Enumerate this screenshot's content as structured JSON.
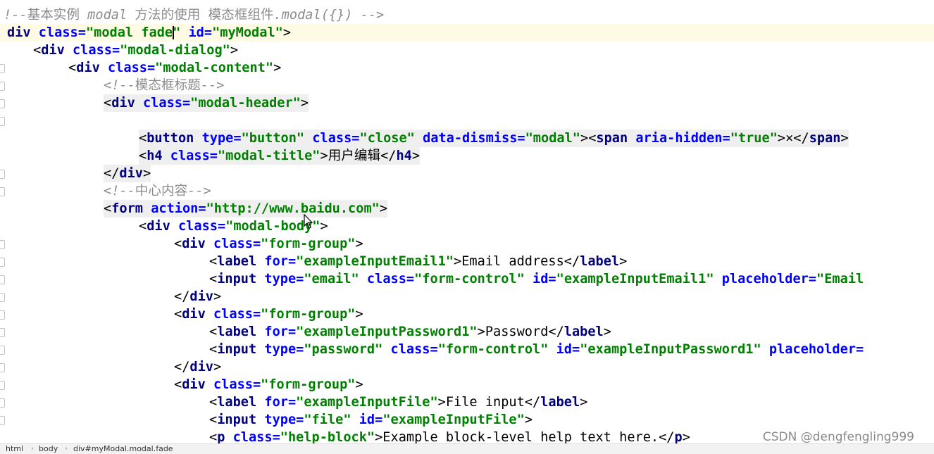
{
  "editor": {
    "lines": [
      {
        "segs": [
          [
            "c",
            "!--基本实例 modal 方法的使用 模态框组件.modal({}) -->"
          ]
        ]
      },
      {
        "current": true,
        "segs": [
          [
            "t",
            "div "
          ],
          [
            "a",
            "class="
          ],
          [
            "v",
            "\"modal fade\""
          ],
          [
            "a",
            " id="
          ],
          [
            "v",
            "\"myModal\""
          ],
          [
            "x",
            ">"
          ]
        ]
      },
      {
        "segs": [
          [
            "x",
            "<"
          ],
          [
            "t",
            "div "
          ],
          [
            "a",
            "class="
          ],
          [
            "v",
            "\"modal-dialog\""
          ],
          [
            "x",
            ">"
          ]
        ]
      },
      {
        "segs": [
          [
            "x",
            "<"
          ],
          [
            "t",
            "div "
          ],
          [
            "a",
            "class="
          ],
          [
            "v",
            "\"modal-content\""
          ],
          [
            "x",
            ">"
          ]
        ]
      },
      {
        "segs": [
          [
            "c",
            "<!--模态框标题-->"
          ]
        ]
      },
      {
        "hl": true,
        "segs": [
          [
            "x",
            "<"
          ],
          [
            "t",
            "div "
          ],
          [
            "a",
            "class="
          ],
          [
            "v",
            "\"modal-header\""
          ],
          [
            "x",
            ">"
          ]
        ]
      },
      {
        "segs": []
      },
      {
        "hl": true,
        "segs": [
          [
            "x",
            "<"
          ],
          [
            "t",
            "button "
          ],
          [
            "a",
            "type="
          ],
          [
            "v",
            "\"button\""
          ],
          [
            "a",
            " class="
          ],
          [
            "v",
            "\"close\""
          ],
          [
            "a",
            " data-dismiss="
          ],
          [
            "v",
            "\"modal\""
          ],
          [
            "x",
            ">"
          ],
          [
            "x",
            "<"
          ],
          [
            "t",
            "span "
          ],
          [
            "a",
            "aria-hidden="
          ],
          [
            "v",
            "\"true\""
          ],
          [
            "x",
            ">"
          ],
          [
            "x",
            "×</"
          ],
          [
            "t",
            "span"
          ],
          [
            "x",
            ">"
          ]
        ]
      },
      {
        "hl": true,
        "segs": [
          [
            "x",
            "<"
          ],
          [
            "t",
            "h4 "
          ],
          [
            "a",
            "class="
          ],
          [
            "v",
            "\"modal-title\""
          ],
          [
            "x",
            ">"
          ],
          [
            "x",
            "用户编辑"
          ],
          [
            "x",
            "</"
          ],
          [
            "t",
            "h4"
          ],
          [
            "x",
            ">"
          ]
        ]
      },
      {
        "hl": true,
        "segs": [
          [
            "x",
            "</"
          ],
          [
            "t",
            "div"
          ],
          [
            "x",
            ">"
          ]
        ]
      },
      {
        "segs": [
          [
            "c",
            "<!--中心内容-->"
          ]
        ]
      },
      {
        "hl": true,
        "segs": [
          [
            "x",
            "<"
          ],
          [
            "t",
            "form "
          ],
          [
            "a",
            "action="
          ],
          [
            "v",
            "\"http://www.baidu.com\""
          ],
          [
            "x",
            ">"
          ]
        ]
      },
      {
        "segs": [
          [
            "x",
            "<"
          ],
          [
            "t",
            "div "
          ],
          [
            "a",
            "class="
          ],
          [
            "v",
            "\"modal-body\""
          ],
          [
            "x",
            ">"
          ]
        ]
      },
      {
        "segs": [
          [
            "x",
            "<"
          ],
          [
            "t",
            "div "
          ],
          [
            "a",
            "class="
          ],
          [
            "v",
            "\"form-group\""
          ],
          [
            "x",
            ">"
          ]
        ]
      },
      {
        "segs": [
          [
            "x",
            "<"
          ],
          [
            "t",
            "label "
          ],
          [
            "a",
            "for="
          ],
          [
            "v",
            "\"exampleInputEmail1\""
          ],
          [
            "x",
            ">Email address</"
          ],
          [
            "t",
            "label"
          ],
          [
            "x",
            ">"
          ]
        ]
      },
      {
        "segs": [
          [
            "x",
            "<"
          ],
          [
            "t",
            "input "
          ],
          [
            "a",
            "type="
          ],
          [
            "v",
            "\"email\""
          ],
          [
            "a",
            " class="
          ],
          [
            "v",
            "\"form-control\""
          ],
          [
            "a",
            " id="
          ],
          [
            "v",
            "\"exampleInputEmail1\""
          ],
          [
            "a",
            " placeholder="
          ],
          [
            "v",
            "\"Email"
          ]
        ]
      },
      {
        "segs": [
          [
            "x",
            "</"
          ],
          [
            "t",
            "div"
          ],
          [
            "x",
            ">"
          ]
        ]
      },
      {
        "segs": [
          [
            "x",
            "<"
          ],
          [
            "t",
            "div "
          ],
          [
            "a",
            "class="
          ],
          [
            "v",
            "\"form-group\""
          ],
          [
            "x",
            ">"
          ]
        ]
      },
      {
        "segs": [
          [
            "x",
            "<"
          ],
          [
            "t",
            "label "
          ],
          [
            "a",
            "for="
          ],
          [
            "v",
            "\"exampleInputPassword1\""
          ],
          [
            "x",
            ">Password</"
          ],
          [
            "t",
            "label"
          ],
          [
            "x",
            ">"
          ]
        ]
      },
      {
        "segs": [
          [
            "x",
            "<"
          ],
          [
            "t",
            "input "
          ],
          [
            "a",
            "type="
          ],
          [
            "v",
            "\"password\""
          ],
          [
            "a",
            " class="
          ],
          [
            "v",
            "\"form-control\""
          ],
          [
            "a",
            " id="
          ],
          [
            "v",
            "\"exampleInputPassword1\""
          ],
          [
            "a",
            " placeholder="
          ]
        ]
      },
      {
        "segs": [
          [
            "x",
            "</"
          ],
          [
            "t",
            "div"
          ],
          [
            "x",
            ">"
          ]
        ]
      },
      {
        "segs": [
          [
            "x",
            "<"
          ],
          [
            "t",
            "div "
          ],
          [
            "a",
            "class="
          ],
          [
            "v",
            "\"form-group\""
          ],
          [
            "x",
            ">"
          ]
        ]
      },
      {
        "segs": [
          [
            "x",
            "<"
          ],
          [
            "t",
            "label "
          ],
          [
            "a",
            "for="
          ],
          [
            "v",
            "\"exampleInputFile\""
          ],
          [
            "x",
            ">File input</"
          ],
          [
            "t",
            "label"
          ],
          [
            "x",
            ">"
          ]
        ]
      },
      {
        "segs": [
          [
            "x",
            "<"
          ],
          [
            "t",
            "input "
          ],
          [
            "a",
            "type="
          ],
          [
            "v",
            "\"file\""
          ],
          [
            "a",
            " id="
          ],
          [
            "v",
            "\"exampleInputFile\""
          ],
          [
            "x",
            ">"
          ]
        ]
      },
      {
        "segs": [
          [
            "x",
            "<"
          ],
          [
            "t",
            "p "
          ],
          [
            "a",
            "class="
          ],
          [
            "v",
            "\"help-block\""
          ],
          [
            "x",
            ">Example block-level help text here.</"
          ],
          [
            "t",
            "p"
          ],
          [
            "x",
            ">"
          ]
        ]
      }
    ]
  },
  "statusbar": {
    "breadcrumbs": [
      "html",
      "body",
      "div#myModal.modal.fade"
    ]
  },
  "watermark": "CSDN @dengfengling999"
}
